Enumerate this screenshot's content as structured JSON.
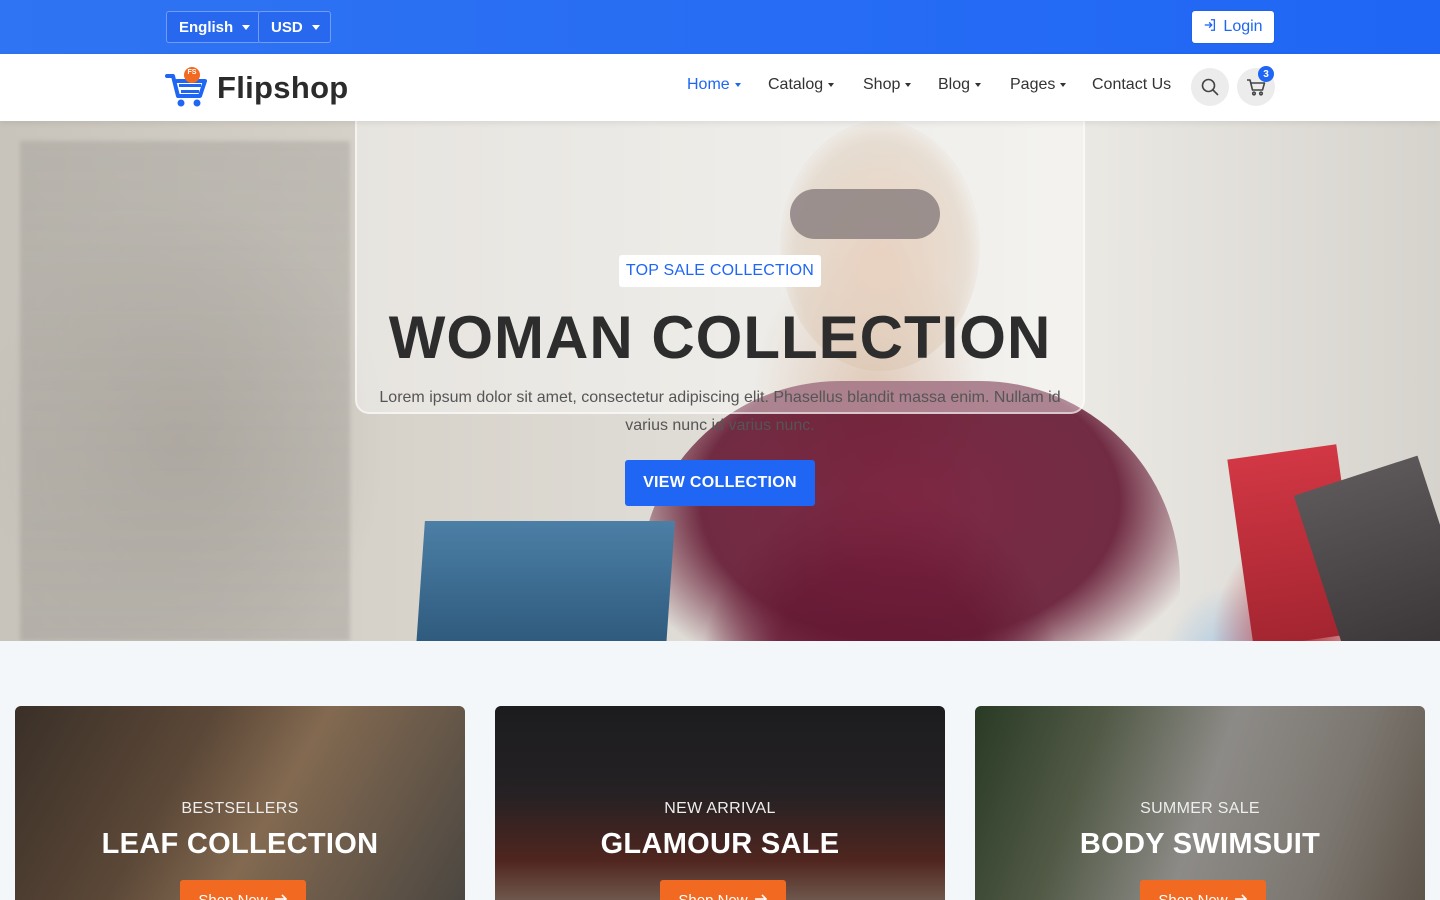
{
  "topbar": {
    "language": "English",
    "currency": "USD",
    "login_label": "Login"
  },
  "header": {
    "brand": "Flipshop",
    "logo_badge": "FS",
    "nav": [
      {
        "label": "Home",
        "active": true,
        "dropdown": true
      },
      {
        "label": "Catalog",
        "active": false,
        "dropdown": true
      },
      {
        "label": "Shop",
        "active": false,
        "dropdown": true
      },
      {
        "label": "Blog",
        "active": false,
        "dropdown": true
      },
      {
        "label": "Pages",
        "active": false,
        "dropdown": true
      },
      {
        "label": "Contact Us",
        "active": false,
        "dropdown": false
      }
    ],
    "cart_count": "3"
  },
  "hero": {
    "tag": "TOP SALE COLLECTION",
    "title": "WOMAN COLLECTION",
    "text": "Lorem ipsum dolor sit amet, consectetur adipiscing elit. Phasellus blandit massa enim. Nullam id varius nunc id varius nunc.",
    "button": "VIEW COLLECTION"
  },
  "cards": [
    {
      "subtitle": "BESTSELLERS",
      "title": "LEAF COLLECTION",
      "button": "Shop Now"
    },
    {
      "subtitle": "NEW ARRIVAL",
      "title": "GLAMOUR SALE",
      "button": "Shop Now"
    },
    {
      "subtitle": "SUMMER SALE",
      "title": "BODY SWIMSUIT",
      "button": "Shop Now"
    }
  ],
  "colors": {
    "primary": "#1f66f5",
    "accent": "#f26a21",
    "logo_badge": "#f26a21"
  }
}
